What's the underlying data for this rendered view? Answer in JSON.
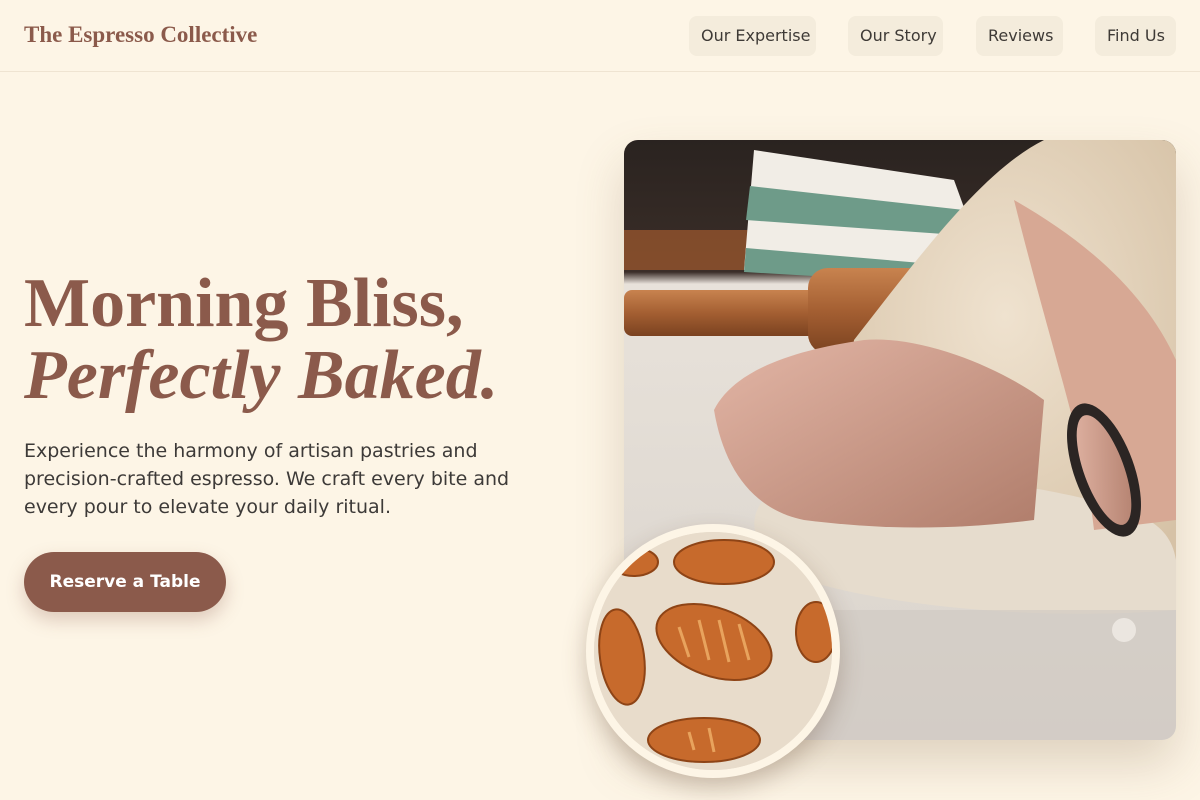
{
  "brand": {
    "name": "The Espresso Collective"
  },
  "nav": {
    "items": [
      {
        "label": "Our Expertise"
      },
      {
        "label": "Our Story"
      },
      {
        "label": "Reviews"
      },
      {
        "label": "Find Us"
      }
    ]
  },
  "hero": {
    "headline_line1": "Morning Bliss,",
    "headline_line2": "Perfectly Baked.",
    "description": "Experience the harmony of artisan pastries and precision-crafted espresso. We craft every bite and every pour to elevate your daily ritual.",
    "cta_label": "Reserve a Table"
  },
  "images": {
    "main": "hands kneading dough with rolling pin and striped towel",
    "inset": "croissants on baking tray"
  },
  "colors": {
    "background": "#fdf5e6",
    "accent": "#8b5a4b",
    "nav_button_bg": "#f4ecdc",
    "text": "#3d3a38"
  }
}
